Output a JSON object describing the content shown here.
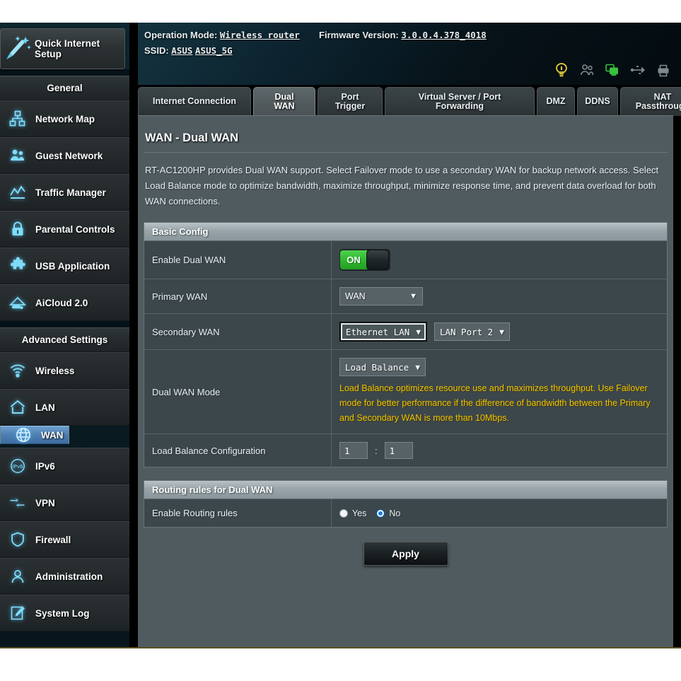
{
  "header": {
    "operation_mode_label": "Operation Mode:",
    "operation_mode_value": "Wireless router",
    "firmware_label": "Firmware Version:",
    "firmware_value": "3.0.0.4.378_4018",
    "ssid_label": "SSID:",
    "ssid_value_1": "ASUS",
    "ssid_value_2": "ASUS_5G",
    "status_icons": [
      {
        "name": "alert-icon",
        "color": "#e8d13a"
      },
      {
        "name": "clients-icon",
        "color": "#7e8a8e"
      },
      {
        "name": "network-monitor-icon",
        "color": "#39c23b"
      },
      {
        "name": "usb-icon",
        "color": "#7e8a8e"
      },
      {
        "name": "printer-icon",
        "color": "#7e8a8e"
      }
    ]
  },
  "sidebar": {
    "quick_setup": "Quick Internet Setup",
    "general_label": "General",
    "general_items": [
      {
        "label": "Network Map",
        "icon": "network-map-icon"
      },
      {
        "label": "Guest Network",
        "icon": "guest-network-icon"
      },
      {
        "label": "Traffic Manager",
        "icon": "traffic-manager-icon"
      },
      {
        "label": "Parental Controls",
        "icon": "lock-icon"
      },
      {
        "label": "USB Application",
        "icon": "puzzle-icon"
      },
      {
        "label": "AiCloud 2.0",
        "icon": "cloud-icon"
      }
    ],
    "advanced_label": "Advanced Settings",
    "advanced_items": [
      {
        "label": "Wireless",
        "icon": "wifi-icon"
      },
      {
        "label": "LAN",
        "icon": "home-icon"
      },
      {
        "label": "WAN",
        "icon": "globe-icon"
      },
      {
        "label": "IPv6",
        "icon": "ipv6-icon"
      },
      {
        "label": "VPN",
        "icon": "vpn-icon"
      },
      {
        "label": "Firewall",
        "icon": "shield-icon"
      },
      {
        "label": "Administration",
        "icon": "user-icon"
      },
      {
        "label": "System Log",
        "icon": "log-icon"
      }
    ],
    "selected": "WAN"
  },
  "tabs": [
    {
      "label": "Internet Connection",
      "active": false
    },
    {
      "label": "Dual WAN",
      "active": true
    },
    {
      "label": "Port Trigger",
      "active": false
    },
    {
      "label": "Virtual Server / Port Forwarding",
      "active": false
    },
    {
      "label": "DMZ",
      "active": false
    },
    {
      "label": "DDNS",
      "active": false
    },
    {
      "label": "NAT Passthrough",
      "active": false
    }
  ],
  "main": {
    "page_title": "WAN - Dual WAN",
    "description": "RT-AC1200HP provides Dual WAN support. Select Failover mode to use a secondary WAN for backup network access. Select Load Balance mode to optimize bandwidth, maximize throughput, minimize response time, and prevent data overload for both WAN connections.",
    "basic_config": {
      "title": "Basic Config",
      "enable_dual_wan_label": "Enable Dual WAN",
      "enable_dual_wan_state": "ON",
      "primary_wan_label": "Primary WAN",
      "primary_wan_value": "WAN",
      "secondary_wan_label": "Secondary WAN",
      "secondary_wan_value": "Ethernet LAN",
      "secondary_wan_port_value": "LAN Port 2",
      "dual_wan_mode_label": "Dual WAN Mode",
      "dual_wan_mode_value": "Load Balance",
      "dual_wan_mode_hint": "Load Balance optimizes resource use and maximizes throughput. Use Failover mode for better performance if the difference of bandwidth between the Primary and Secondary WAN is more than 10Mbps.",
      "load_balance_label": "Load Balance Configuration",
      "load_balance_value_1": "1",
      "load_balance_separator": ":",
      "load_balance_value_2": "1"
    },
    "routing_rules": {
      "title": "Routing rules for Dual WAN",
      "enable_label": "Enable Routing rules",
      "yes_label": "Yes",
      "no_label": "No",
      "selected": "No"
    },
    "apply_label": "Apply"
  },
  "colors": {
    "accent_blue": "#4f81b4",
    "hint_yellow": "#f0c000",
    "toggle_green": "#2fb52f",
    "panel_bg": "#3c474b"
  }
}
